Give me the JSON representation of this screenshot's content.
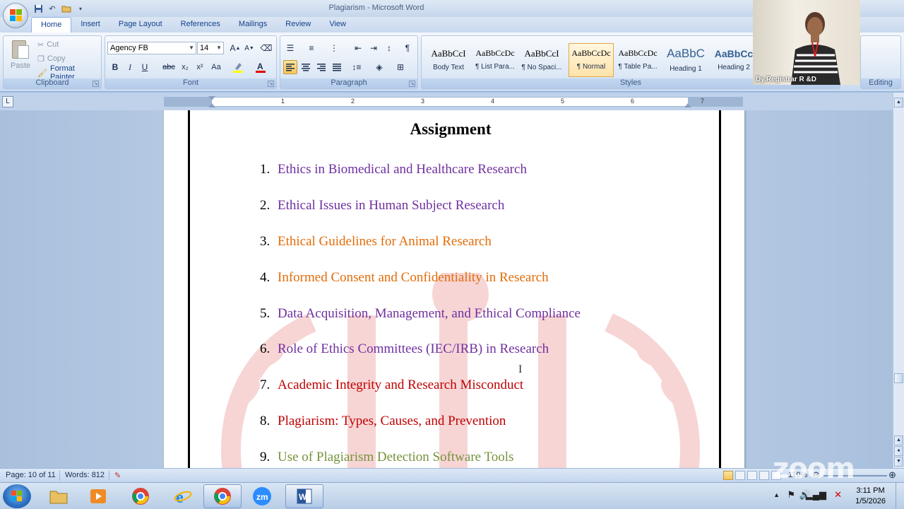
{
  "window": {
    "title": "Plagiarism - Microsoft Word",
    "title_faded": "Plagiarism - Microsoft Word"
  },
  "ribbon": {
    "tabs": [
      "Home",
      "Insert",
      "Page Layout",
      "References",
      "Mailings",
      "Review",
      "View"
    ],
    "active_tab": "Home",
    "clipboard": {
      "paste": "Paste",
      "cut": "Cut",
      "copy": "Copy",
      "format_painter": "Format Painter",
      "label": "Clipboard"
    },
    "font": {
      "font_name": "Agency FB",
      "font_size": "14",
      "label": "Font",
      "highlight_color": "#ffff00",
      "font_color": "#e00000"
    },
    "paragraph": {
      "label": "Paragraph"
    },
    "styles": {
      "label": "Styles",
      "items": [
        {
          "sample": "AaBbCcI",
          "name": "Body Text"
        },
        {
          "sample": "AaBbCcDc",
          "name": "¶ List Para..."
        },
        {
          "sample": "AaBbCcI",
          "name": "¶ No Spaci..."
        },
        {
          "sample": "AaBbCcDc",
          "name": "¶ Normal"
        },
        {
          "sample": "AaBbCcDc",
          "name": "¶ Table Pa..."
        },
        {
          "sample": "AaBbC",
          "name": "Heading 1"
        },
        {
          "sample": "AaBbCc",
          "name": "Heading 2"
        }
      ],
      "selected": "¶ Normal"
    },
    "editing": {
      "label": "Editing"
    }
  },
  "ruler": {
    "numbers": [
      "1",
      "2",
      "3",
      "4",
      "5",
      "6",
      "7"
    ]
  },
  "document": {
    "title": "Assignment",
    "items": [
      {
        "num": "1.",
        "text": "Ethics in Biomedical and Healthcare Research",
        "color": "#7030a0"
      },
      {
        "num": "2.",
        "text": "Ethical Issues in Human Subject Research",
        "color": "#7030a0"
      },
      {
        "num": "3.",
        "text": "Ethical Guidelines for Animal Research",
        "color": "#e36c09"
      },
      {
        "num": "4.",
        "text": "Informed Consent and Confidentiality in Research",
        "color": "#e36c09"
      },
      {
        "num": "5.",
        "text": "Data Acquisition, Management, and Ethical Compliance",
        "color": "#7030a0"
      },
      {
        "num": "6.",
        "text": "Role of Ethics Committees (IEC/IRB) in Research",
        "color": "#7030a0"
      },
      {
        "num": "7.",
        "text": "Academic Integrity and Research Misconduct",
        "color": "#c00000"
      },
      {
        "num": "8.",
        "text": "Plagiarism: Types, Causes, and Prevention",
        "color": "#c00000"
      },
      {
        "num": "9.",
        "text": "Use of Plagiarism Detection Software Tools",
        "color": "#76923c"
      }
    ]
  },
  "statusbar": {
    "page": "Page: 10 of 11",
    "words": "Words: 812",
    "zoom": "110%"
  },
  "taskbar": {
    "apps": [
      "windows-explorer",
      "media-player",
      "google-chrome",
      "internet-explorer",
      "google-chrome-active",
      "zoom",
      "microsoft-word"
    ],
    "time": "3:11 PM",
    "date": "1/5/2026"
  },
  "webcam": {
    "participant_name": "Dy.Registrar R &D"
  },
  "overlay": {
    "zoom_watermark": "zoom"
  }
}
